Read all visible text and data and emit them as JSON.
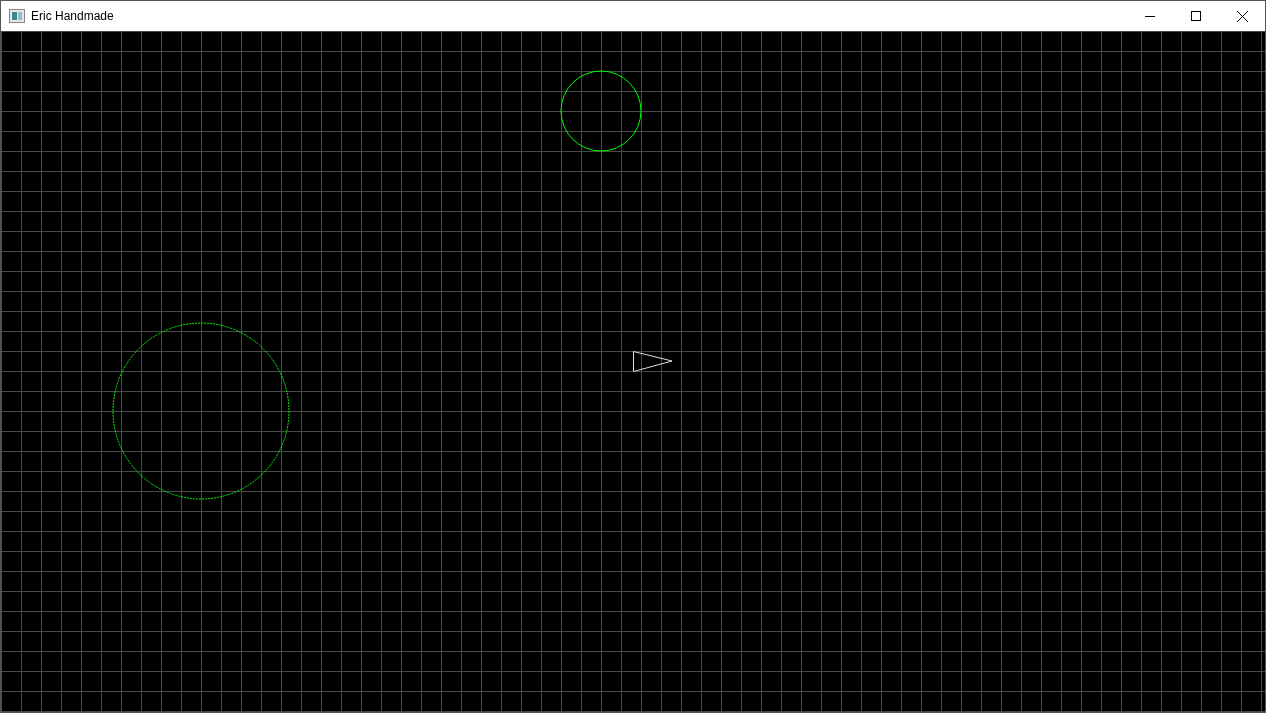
{
  "window": {
    "title": "Eric Handmade"
  }
}
